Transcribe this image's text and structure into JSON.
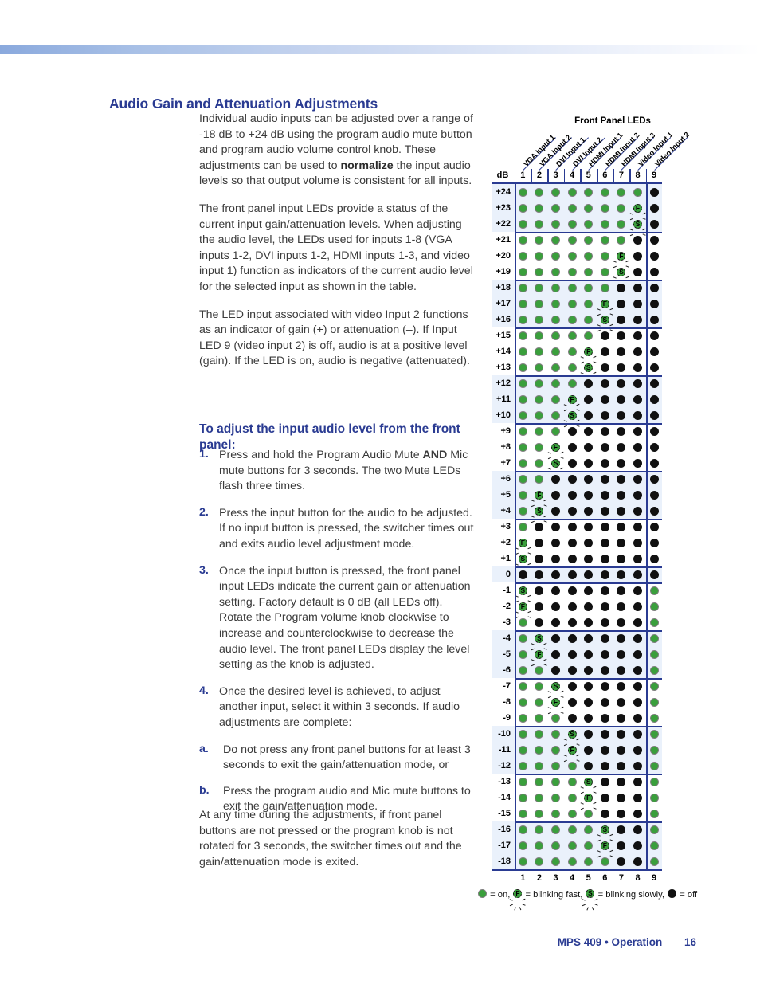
{
  "document": {
    "heading": "Audio Gain and Attenuation Adjustments",
    "paragraphs": [
      "Individual audio inputs can be adjusted over a range of -18 dB to +24 dB using the program audio mute button and program audio volume control knob. These adjustments can be used to <b>normalize</b> the input audio levels so that output volume is consistent for all inputs.",
      "The front panel input LEDs provide a status of the current input gain/attenuation levels. When adjusting the audio level, the LEDs used for inputs 1-8 (VGA inputs 1-2, DVI inputs 1-2, HDMI inputs 1-3, and video input 1) function as indicators of the current audio level for the selected input as shown in the table.",
      "The LED input associated with video Input 2 functions as an indicator of gain (+) or attenuation (–). If Input LED 9 (video input 2) is off, audio is at a positive level (gain). If the LED is on, audio is negative (attenuated)."
    ],
    "subheading": "To adjust the input audio level from the front panel:",
    "steps": [
      {
        "num": "1.",
        "text": "Press and hold the Program Audio Mute <b>AND</b> Mic mute buttons for 3 seconds. The two Mute LEDs flash three times."
      },
      {
        "num": "2.",
        "text": "Press the input button for the audio to be adjusted. If no input button is pressed, the switcher times out and exits audio level adjustment mode."
      },
      {
        "num": "3.",
        "text": "Once the input button is pressed, the front panel input LEDs indicate the current gain or attenuation setting. Factory default is 0 dB (all LEDs off). Rotate the Program volume knob clockwise to increase and counterclockwise to decrease the audio level. The front panel LEDs display the level setting as the knob is adjusted."
      },
      {
        "num": "4.",
        "text": "Once the desired level is achieved, to adjust another input, select it within 3 seconds. If audio adjustments are complete:"
      }
    ],
    "substeps": [
      {
        "num": "a.",
        "text": "Do not press any front panel buttons for at least 3 seconds to exit the gain/attenuation mode, or"
      },
      {
        "num": "b.",
        "text": "Press the program audio and Mic mute buttons to exit the gain/attenuation mode."
      }
    ],
    "closing": "At any time during the adjustments, if front panel buttons are not pressed or the program knob is not rotated for 3 seconds, the switcher times out and the gain/attenuation mode is exited."
  },
  "footer": {
    "title": "MPS 409 • Operation",
    "page": "16"
  },
  "chart_data": {
    "type": "table",
    "title": "Front Panel LEDs",
    "corner_label": "dB",
    "column_numbers": [
      "1",
      "2",
      "3",
      "4",
      "5",
      "6",
      "7",
      "8",
      "9"
    ],
    "column_labels": [
      "VGA Input 1",
      "VGA Input 2",
      "DVI Input 1",
      "DVI Input 2",
      "HDMI Input 1",
      "HDMI Input 2",
      "HDMI Input 3",
      "Video Input 1",
      "Video Input 2"
    ],
    "legend": [
      {
        "state": "on",
        "glyph": "",
        "text": "= on,"
      },
      {
        "state": "blink",
        "glyph": "F",
        "text": "= blinking fast,"
      },
      {
        "state": "blink",
        "glyph": "S",
        "text": "= blinking slowly,"
      },
      {
        "state": "off",
        "glyph": "",
        "text": "= off"
      }
    ],
    "colors": {
      "led_on": "#3a9f3c",
      "led_off": "#111111",
      "rule": "#2a3b92",
      "band_shade": "#eaf1fb",
      "accent_text": "#2a3b92"
    },
    "bands": [
      {
        "shade": true,
        "rows": [
          {
            "db": "+24",
            "leds": [
              "on",
              "on",
              "on",
              "on",
              "on",
              "on",
              "on",
              "on",
              "off"
            ]
          },
          {
            "db": "+23",
            "leds": [
              "on",
              "on",
              "on",
              "on",
              "on",
              "on",
              "on",
              "F",
              "off"
            ]
          },
          {
            "db": "+22",
            "leds": [
              "on",
              "on",
              "on",
              "on",
              "on",
              "on",
              "on",
              "S",
              "off"
            ]
          }
        ]
      },
      {
        "shade": false,
        "rows": [
          {
            "db": "+21",
            "leds": [
              "on",
              "on",
              "on",
              "on",
              "on",
              "on",
              "on",
              "off",
              "off"
            ]
          },
          {
            "db": "+20",
            "leds": [
              "on",
              "on",
              "on",
              "on",
              "on",
              "on",
              "F",
              "off",
              "off"
            ]
          },
          {
            "db": "+19",
            "leds": [
              "on",
              "on",
              "on",
              "on",
              "on",
              "on",
              "S",
              "off",
              "off"
            ]
          }
        ]
      },
      {
        "shade": true,
        "rows": [
          {
            "db": "+18",
            "leds": [
              "on",
              "on",
              "on",
              "on",
              "on",
              "on",
              "off",
              "off",
              "off"
            ]
          },
          {
            "db": "+17",
            "leds": [
              "on",
              "on",
              "on",
              "on",
              "on",
              "F",
              "off",
              "off",
              "off"
            ]
          },
          {
            "db": "+16",
            "leds": [
              "on",
              "on",
              "on",
              "on",
              "on",
              "S",
              "off",
              "off",
              "off"
            ]
          }
        ]
      },
      {
        "shade": false,
        "rows": [
          {
            "db": "+15",
            "leds": [
              "on",
              "on",
              "on",
              "on",
              "on",
              "off",
              "off",
              "off",
              "off"
            ]
          },
          {
            "db": "+14",
            "leds": [
              "on",
              "on",
              "on",
              "on",
              "F",
              "off",
              "off",
              "off",
              "off"
            ]
          },
          {
            "db": "+13",
            "leds": [
              "on",
              "on",
              "on",
              "on",
              "S",
              "off",
              "off",
              "off",
              "off"
            ]
          }
        ]
      },
      {
        "shade": true,
        "rows": [
          {
            "db": "+12",
            "leds": [
              "on",
              "on",
              "on",
              "on",
              "off",
              "off",
              "off",
              "off",
              "off"
            ]
          },
          {
            "db": "+11",
            "leds": [
              "on",
              "on",
              "on",
              "F",
              "off",
              "off",
              "off",
              "off",
              "off"
            ]
          },
          {
            "db": "+10",
            "leds": [
              "on",
              "on",
              "on",
              "S",
              "off",
              "off",
              "off",
              "off",
              "off"
            ]
          }
        ]
      },
      {
        "shade": false,
        "rows": [
          {
            "db": "+9",
            "leds": [
              "on",
              "on",
              "on",
              "off",
              "off",
              "off",
              "off",
              "off",
              "off"
            ]
          },
          {
            "db": "+8",
            "leds": [
              "on",
              "on",
              "F",
              "off",
              "off",
              "off",
              "off",
              "off",
              "off"
            ]
          },
          {
            "db": "+7",
            "leds": [
              "on",
              "on",
              "S",
              "off",
              "off",
              "off",
              "off",
              "off",
              "off"
            ]
          }
        ]
      },
      {
        "shade": true,
        "rows": [
          {
            "db": "+6",
            "leds": [
              "on",
              "on",
              "off",
              "off",
              "off",
              "off",
              "off",
              "off",
              "off"
            ]
          },
          {
            "db": "+5",
            "leds": [
              "on",
              "F",
              "off",
              "off",
              "off",
              "off",
              "off",
              "off",
              "off"
            ]
          },
          {
            "db": "+4",
            "leds": [
              "on",
              "S",
              "off",
              "off",
              "off",
              "off",
              "off",
              "off",
              "off"
            ]
          }
        ]
      },
      {
        "shade": false,
        "rows": [
          {
            "db": "+3",
            "leds": [
              "on",
              "off",
              "off",
              "off",
              "off",
              "off",
              "off",
              "off",
              "off"
            ]
          },
          {
            "db": "+2",
            "leds": [
              "F",
              "off",
              "off",
              "off",
              "off",
              "off",
              "off",
              "off",
              "off"
            ]
          },
          {
            "db": "+1",
            "leds": [
              "S",
              "off",
              "off",
              "off",
              "off",
              "off",
              "off",
              "off",
              "off"
            ]
          }
        ]
      },
      {
        "shade": true,
        "rows": [
          {
            "db": "0",
            "leds": [
              "off",
              "off",
              "off",
              "off",
              "off",
              "off",
              "off",
              "off",
              "off"
            ]
          }
        ]
      },
      {
        "shade": false,
        "rows": [
          {
            "db": "-1",
            "leds": [
              "S",
              "off",
              "off",
              "off",
              "off",
              "off",
              "off",
              "off",
              "on"
            ]
          },
          {
            "db": "-2",
            "leds": [
              "F",
              "off",
              "off",
              "off",
              "off",
              "off",
              "off",
              "off",
              "on"
            ]
          },
          {
            "db": "-3",
            "leds": [
              "on",
              "off",
              "off",
              "off",
              "off",
              "off",
              "off",
              "off",
              "on"
            ]
          }
        ]
      },
      {
        "shade": true,
        "rows": [
          {
            "db": "-4",
            "leds": [
              "on",
              "S",
              "off",
              "off",
              "off",
              "off",
              "off",
              "off",
              "on"
            ]
          },
          {
            "db": "-5",
            "leds": [
              "on",
              "F",
              "off",
              "off",
              "off",
              "off",
              "off",
              "off",
              "on"
            ]
          },
          {
            "db": "-6",
            "leds": [
              "on",
              "on",
              "off",
              "off",
              "off",
              "off",
              "off",
              "off",
              "on"
            ]
          }
        ]
      },
      {
        "shade": false,
        "rows": [
          {
            "db": "-7",
            "leds": [
              "on",
              "on",
              "S",
              "off",
              "off",
              "off",
              "off",
              "off",
              "on"
            ]
          },
          {
            "db": "-8",
            "leds": [
              "on",
              "on",
              "F",
              "off",
              "off",
              "off",
              "off",
              "off",
              "on"
            ]
          },
          {
            "db": "-9",
            "leds": [
              "on",
              "on",
              "on",
              "off",
              "off",
              "off",
              "off",
              "off",
              "on"
            ]
          }
        ]
      },
      {
        "shade": true,
        "rows": [
          {
            "db": "-10",
            "leds": [
              "on",
              "on",
              "on",
              "S",
              "off",
              "off",
              "off",
              "off",
              "on"
            ]
          },
          {
            "db": "-11",
            "leds": [
              "on",
              "on",
              "on",
              "F",
              "off",
              "off",
              "off",
              "off",
              "on"
            ]
          },
          {
            "db": "-12",
            "leds": [
              "on",
              "on",
              "on",
              "on",
              "off",
              "off",
              "off",
              "off",
              "on"
            ]
          }
        ]
      },
      {
        "shade": false,
        "rows": [
          {
            "db": "-13",
            "leds": [
              "on",
              "on",
              "on",
              "on",
              "S",
              "off",
              "off",
              "off",
              "on"
            ]
          },
          {
            "db": "-14",
            "leds": [
              "on",
              "on",
              "on",
              "on",
              "F",
              "off",
              "off",
              "off",
              "on"
            ]
          },
          {
            "db": "-15",
            "leds": [
              "on",
              "on",
              "on",
              "on",
              "on",
              "off",
              "off",
              "off",
              "on"
            ]
          }
        ]
      },
      {
        "shade": true,
        "rows": [
          {
            "db": "-16",
            "leds": [
              "on",
              "on",
              "on",
              "on",
              "on",
              "S",
              "off",
              "off",
              "on"
            ]
          },
          {
            "db": "-17",
            "leds": [
              "on",
              "on",
              "on",
              "on",
              "on",
              "F",
              "off",
              "off",
              "on"
            ]
          },
          {
            "db": "-18",
            "leds": [
              "on",
              "on",
              "on",
              "on",
              "on",
              "on",
              "off",
              "off",
              "on"
            ]
          }
        ]
      }
    ]
  }
}
